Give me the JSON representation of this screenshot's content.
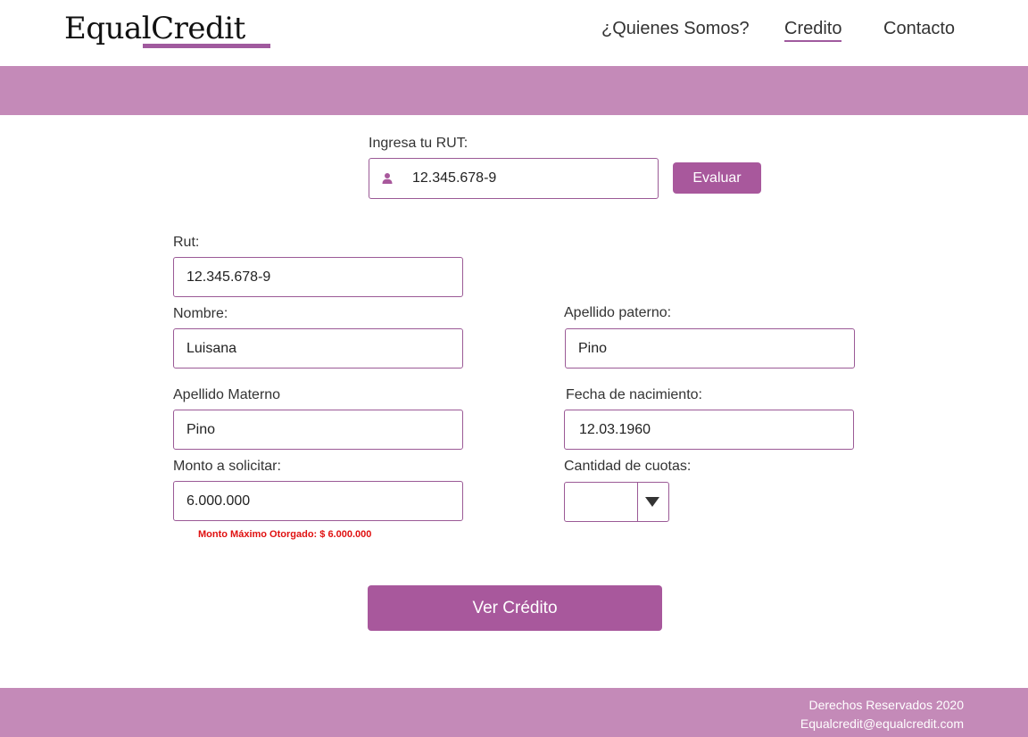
{
  "brand": {
    "name": "EqualCredit",
    "accent": "#a05a9e",
    "band_color": "#c48ab8",
    "button_color": "#a8589c",
    "warning_color": "#e01010"
  },
  "nav": {
    "items": [
      {
        "label": "¿Quienes Somos?"
      },
      {
        "label": "Credito"
      },
      {
        "label": "Contacto"
      }
    ],
    "active": "Credito"
  },
  "search": {
    "label": "Ingresa tu RUT:",
    "value": "12.345.678-9",
    "icon": "user-icon",
    "button": "Evaluar"
  },
  "form": {
    "rut": {
      "label": "Rut:",
      "value": "12.345.678-9"
    },
    "nombre": {
      "label": "Nombre:",
      "value": "Luisana"
    },
    "apellido_paterno": {
      "label": "Apellido paterno:",
      "value": "Pino"
    },
    "apellido_materno": {
      "label": "Apellido Materno",
      "value": "Pino"
    },
    "fecha_nacimiento": {
      "label": "Fecha de nacimiento:",
      "value": "12.03.1960"
    },
    "monto": {
      "label": "Monto a solicitar:",
      "value": "6.000.000",
      "note": "Monto Máximo Otorgado: $ 6.000.000"
    },
    "cuotas": {
      "label": "Cantidad de cuotas:",
      "value": "",
      "icon": "triangle-down-icon"
    },
    "submit": "Ver Crédito"
  },
  "footer": {
    "rights": "Derechos Reservados 2020",
    "email": "Equalcredit@equalcredit.com"
  }
}
